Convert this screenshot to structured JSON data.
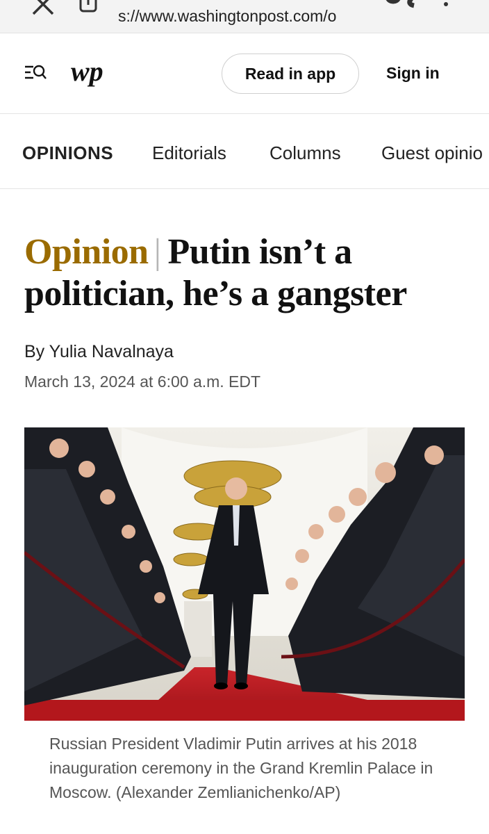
{
  "browser": {
    "url": "s://www.washingtonpost.com/o",
    "close_icon": "close-icon",
    "lock_icon": "lock-icon",
    "more_icon": "kebab-menu-icon"
  },
  "header": {
    "menu_icon": "search-menu-icon",
    "logo": "wp",
    "read_in_app": "Read in app",
    "sign_in": "Sign in"
  },
  "nav": {
    "items": [
      {
        "label": "OPINIONS",
        "active": true
      },
      {
        "label": "Editorials"
      },
      {
        "label": "Columns"
      },
      {
        "label": "Guest opinio"
      }
    ]
  },
  "article": {
    "kicker": "Opinion",
    "divider": "|",
    "title": "Putin isn’t a politician, he’s a gangster",
    "byline": "By Yulia Navalnaya",
    "date": "March 13, 2024 at 6:00 a.m. EDT",
    "image_description_icon": "photo",
    "caption": "Russian President Vladimir Putin arrives at his 2018 inauguration ceremony in the Grand Kremlin Palace in Moscow. (Alexander Zemlianichenko/AP)"
  },
  "colors": {
    "kicker": "#9a6b00",
    "carpet": "#b3171c",
    "gold": "#c9a23a"
  }
}
